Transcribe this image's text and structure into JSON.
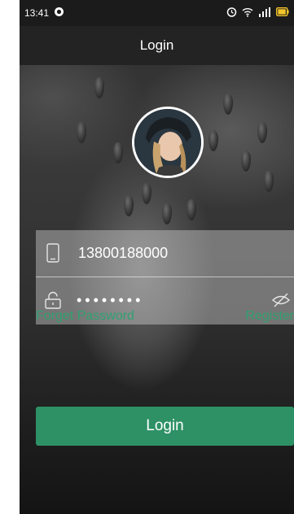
{
  "status_bar": {
    "time": "13:41",
    "signal_label": "☳ıl"
  },
  "header": {
    "title": "Login"
  },
  "form": {
    "phone_value": "13800188000",
    "password_mask": "••••••••"
  },
  "links": {
    "forget_password": "Forget Password",
    "register": "Register"
  },
  "actions": {
    "login_label": "Login"
  },
  "colors": {
    "accent": "#2d9165",
    "link": "#2fa170",
    "battery": "#f3c52b"
  },
  "icons": [
    "phone-icon",
    "lock-icon",
    "eye-off-icon",
    "alarm-icon",
    "wifi-icon",
    "signal-icon",
    "battery-icon",
    "notification-icon"
  ]
}
